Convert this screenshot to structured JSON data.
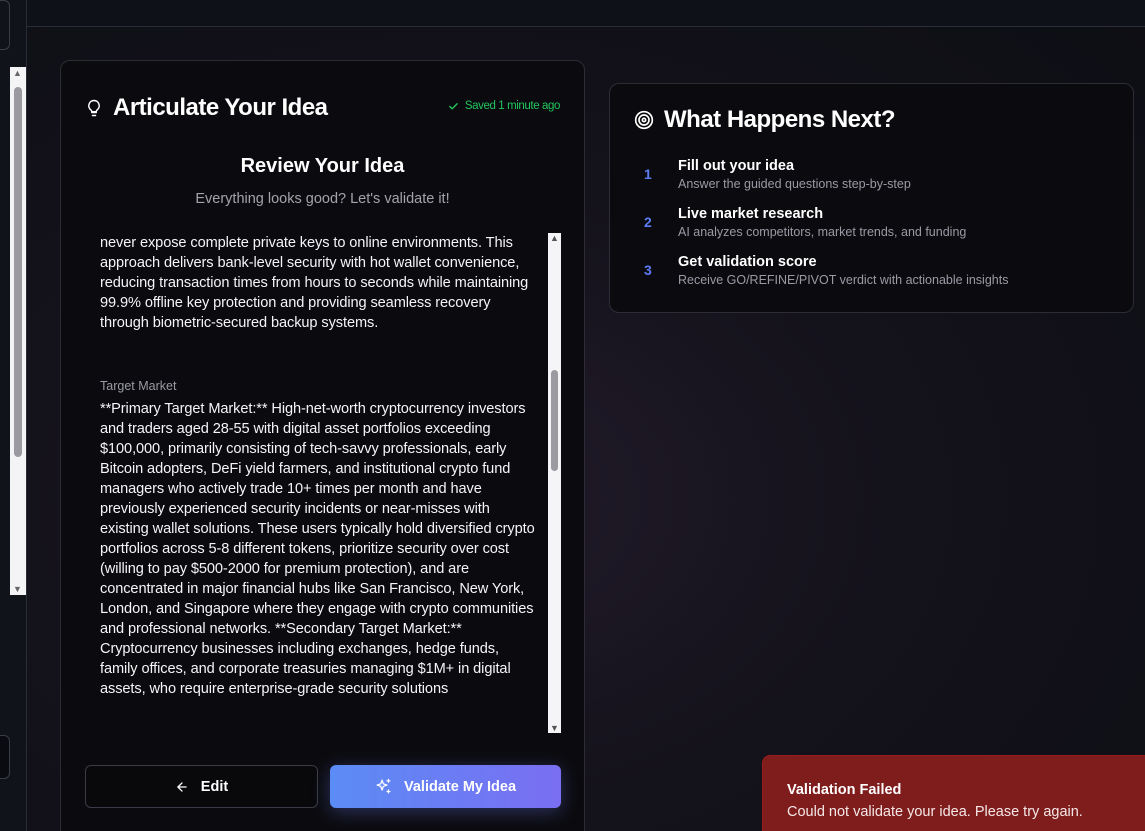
{
  "left_card": {
    "title": "Articulate Your Idea",
    "saved_status": "Saved 1 minute ago",
    "review_title": "Review Your Idea",
    "review_subtitle": "Everything looks good? Let's validate it!",
    "solution_tail": "never expose complete private keys to online environments. This approach delivers bank-level security with hot wallet convenience, reducing transaction times from hours to seconds while maintaining 99.9% offline key protection and providing seamless recovery through biometric-secured backup systems.",
    "target_market_label": "Target Market",
    "target_market_text": "**Primary Target Market:** High-net-worth cryptocurrency investors and traders aged 28-55 with digital asset portfolios exceeding $100,000, primarily consisting of tech-savvy professionals, early Bitcoin adopters, DeFi yield farmers, and institutional crypto fund managers who actively trade 10+ times per month and have previously experienced security incidents or near-misses with existing wallet solutions. These users typically hold diversified crypto portfolios across 5-8 different tokens, prioritize security over cost (willing to pay $500-2000 for premium protection), and are concentrated in major financial hubs like San Francisco, New York, London, and Singapore where they engage with crypto communities and professional networks. **Secondary Target Market:** Cryptocurrency businesses including exchanges, hedge funds, family offices, and corporate treasuries managing $1M+ in digital assets, who require enterprise-grade security solutions",
    "edit_button": "Edit",
    "validate_button": "Validate My Idea"
  },
  "right_card": {
    "title": "What Happens Next?",
    "steps": [
      {
        "num": "1",
        "title": "Fill out your idea",
        "desc": "Answer the guided questions step-by-step"
      },
      {
        "num": "2",
        "title": "Live market research",
        "desc": "AI analyzes competitors, market trends, and funding"
      },
      {
        "num": "3",
        "title": "Get validation score",
        "desc": "Receive GO/REFINE/PIVOT verdict with actionable insights"
      }
    ]
  },
  "toast": {
    "title": "Validation Failed",
    "message": "Could not validate your idea. Please try again."
  },
  "colors": {
    "accent_blue": "#5b8cf5",
    "accent_purple": "#7a6ef2",
    "success_green": "#22c55e",
    "error_red": "#7f1d1d"
  }
}
